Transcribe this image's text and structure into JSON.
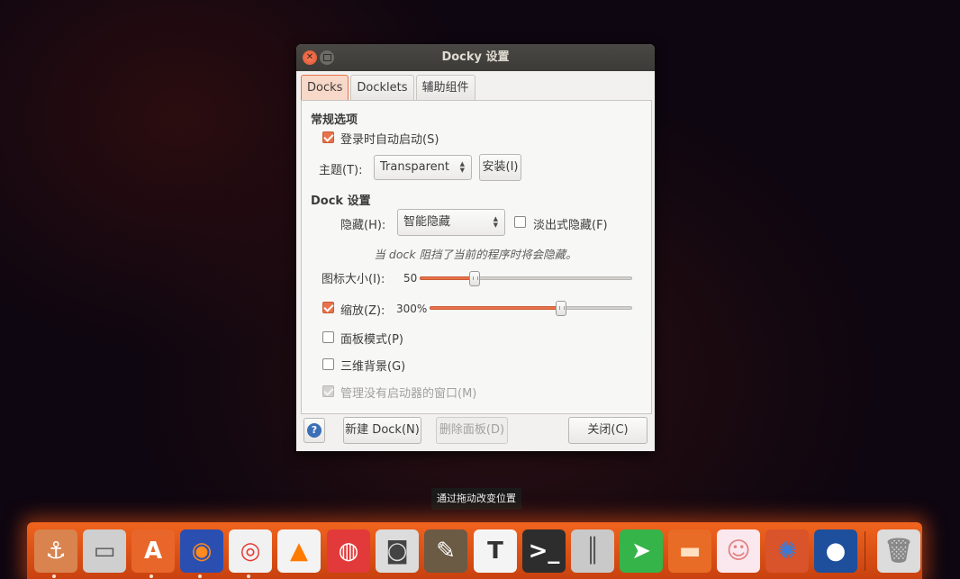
{
  "window": {
    "title": "Docky 设置",
    "tabs": [
      "Docks",
      "Docklets",
      "辅助组件"
    ],
    "active_tab": "Docks"
  },
  "general": {
    "heading": "常规选项",
    "autostart_label": "登录时自动启动(S)",
    "autostart_checked": true,
    "theme_label": "主题(T):",
    "theme_value": "Transparent",
    "install_label": "安装(I)"
  },
  "dock_settings": {
    "heading": "Dock 设置",
    "hide_label": "隐藏(H):",
    "hide_value": "智能隐藏",
    "fade_label": "淡出式隐藏(F)",
    "fade_checked": false,
    "hint": "当 dock 阻挡了当前的程序时将会隐藏。",
    "icon_size_label": "图标大小(I):",
    "icon_size_value": "50",
    "icon_size_fraction": 0.26,
    "zoom_label": "缩放(Z):",
    "zoom_checked": true,
    "zoom_value": "300%",
    "zoom_fraction": 0.65,
    "panel_mode_label": "面板模式(P)",
    "panel_mode_checked": false,
    "bg3d_label": "三维背景(G)",
    "bg3d_checked": false,
    "manage_label": "管理没有启动器的窗口(M)",
    "manage_checked": true,
    "manage_disabled": true
  },
  "footer": {
    "help_glyph": "?",
    "new_dock_label": "新建 Dock(N)",
    "delete_panel_label": "删除面板(D)",
    "close_label": "关闭(C)"
  },
  "tooltip": "通过拖动改变位置",
  "dock": {
    "items": [
      {
        "name": "docky-anchor",
        "glyph": "⚓"
      },
      {
        "name": "file-cabinet",
        "glyph": "▭"
      },
      {
        "name": "software-center",
        "glyph": "A"
      },
      {
        "name": "firefox",
        "glyph": "◉"
      },
      {
        "name": "chrome",
        "glyph": "◎"
      },
      {
        "name": "vlc",
        "glyph": "▲"
      },
      {
        "name": "netease-music",
        "glyph": "◍"
      },
      {
        "name": "camera",
        "glyph": "◙"
      },
      {
        "name": "gimp",
        "glyph": "✎"
      },
      {
        "name": "text-editor",
        "glyph": "T"
      },
      {
        "name": "terminal",
        "glyph": ">_"
      },
      {
        "name": "mixer",
        "glyph": "║"
      },
      {
        "name": "send-app",
        "glyph": "➤"
      },
      {
        "name": "folder",
        "glyph": "▬"
      },
      {
        "name": "anime-avatar",
        "glyph": "☺"
      },
      {
        "name": "shutter",
        "glyph": "✺"
      },
      {
        "name": "qq",
        "glyph": "●"
      },
      {
        "name": "trash",
        "glyph": "🗑"
      }
    ],
    "colors": {
      "bar": "#e9591b",
      "accent": "#e9724a"
    }
  }
}
